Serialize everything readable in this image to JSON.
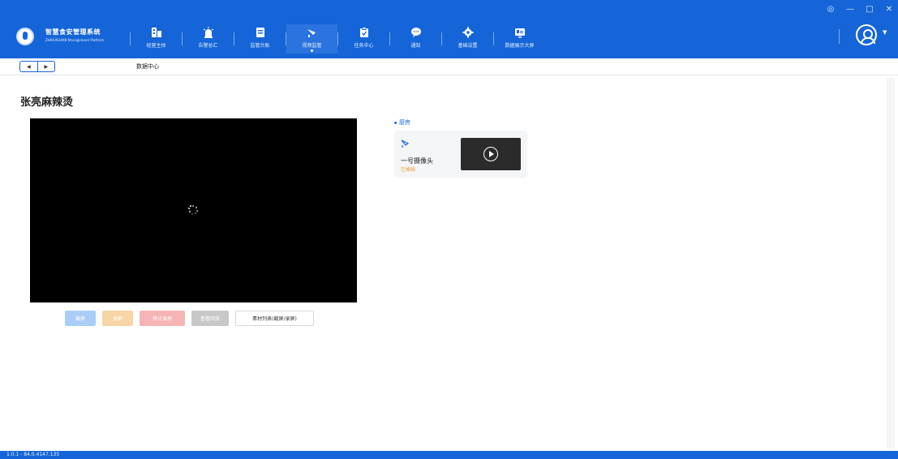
{
  "window": {
    "controls": [
      "◎",
      "—",
      "□",
      "✕"
    ]
  },
  "brand": {
    "title": "智慧食安管理系统",
    "subtitle": "ZHIHUISHIAN Management Platform"
  },
  "nav": {
    "items": [
      {
        "label": "经营主体",
        "icon": "building-icon"
      },
      {
        "label": "告警总汇",
        "icon": "alarm-icon"
      },
      {
        "label": "监管台账",
        "icon": "ledger-icon"
      },
      {
        "label": "视频监管",
        "icon": "camera-icon",
        "active": true
      },
      {
        "label": "任务中心",
        "icon": "clipboard-icon"
      },
      {
        "label": "通知",
        "icon": "chat-icon"
      },
      {
        "label": "基础设置",
        "icon": "gear-icon"
      },
      {
        "label": "数据展示大屏",
        "icon": "display-icon"
      }
    ]
  },
  "tabs": {
    "back": "◀",
    "forward": "▶",
    "current": "数据中心"
  },
  "page": {
    "title": "张亮麻辣烫"
  },
  "controls": {
    "screenshot": "截屏",
    "record": "录屏",
    "stop_record": "停止录屏",
    "playback": "查看回放",
    "materials": "素材列表(截屏/录屏)"
  },
  "camera_group": {
    "name": "厨房",
    "cameras": [
      {
        "name": "一号摄像头",
        "status": "已掉线"
      }
    ]
  },
  "colors": {
    "primary": "#1565d8",
    "offline": "#e69a2e"
  },
  "statusbar": {
    "version": "1.0.1 - 84.0.4147.135"
  }
}
